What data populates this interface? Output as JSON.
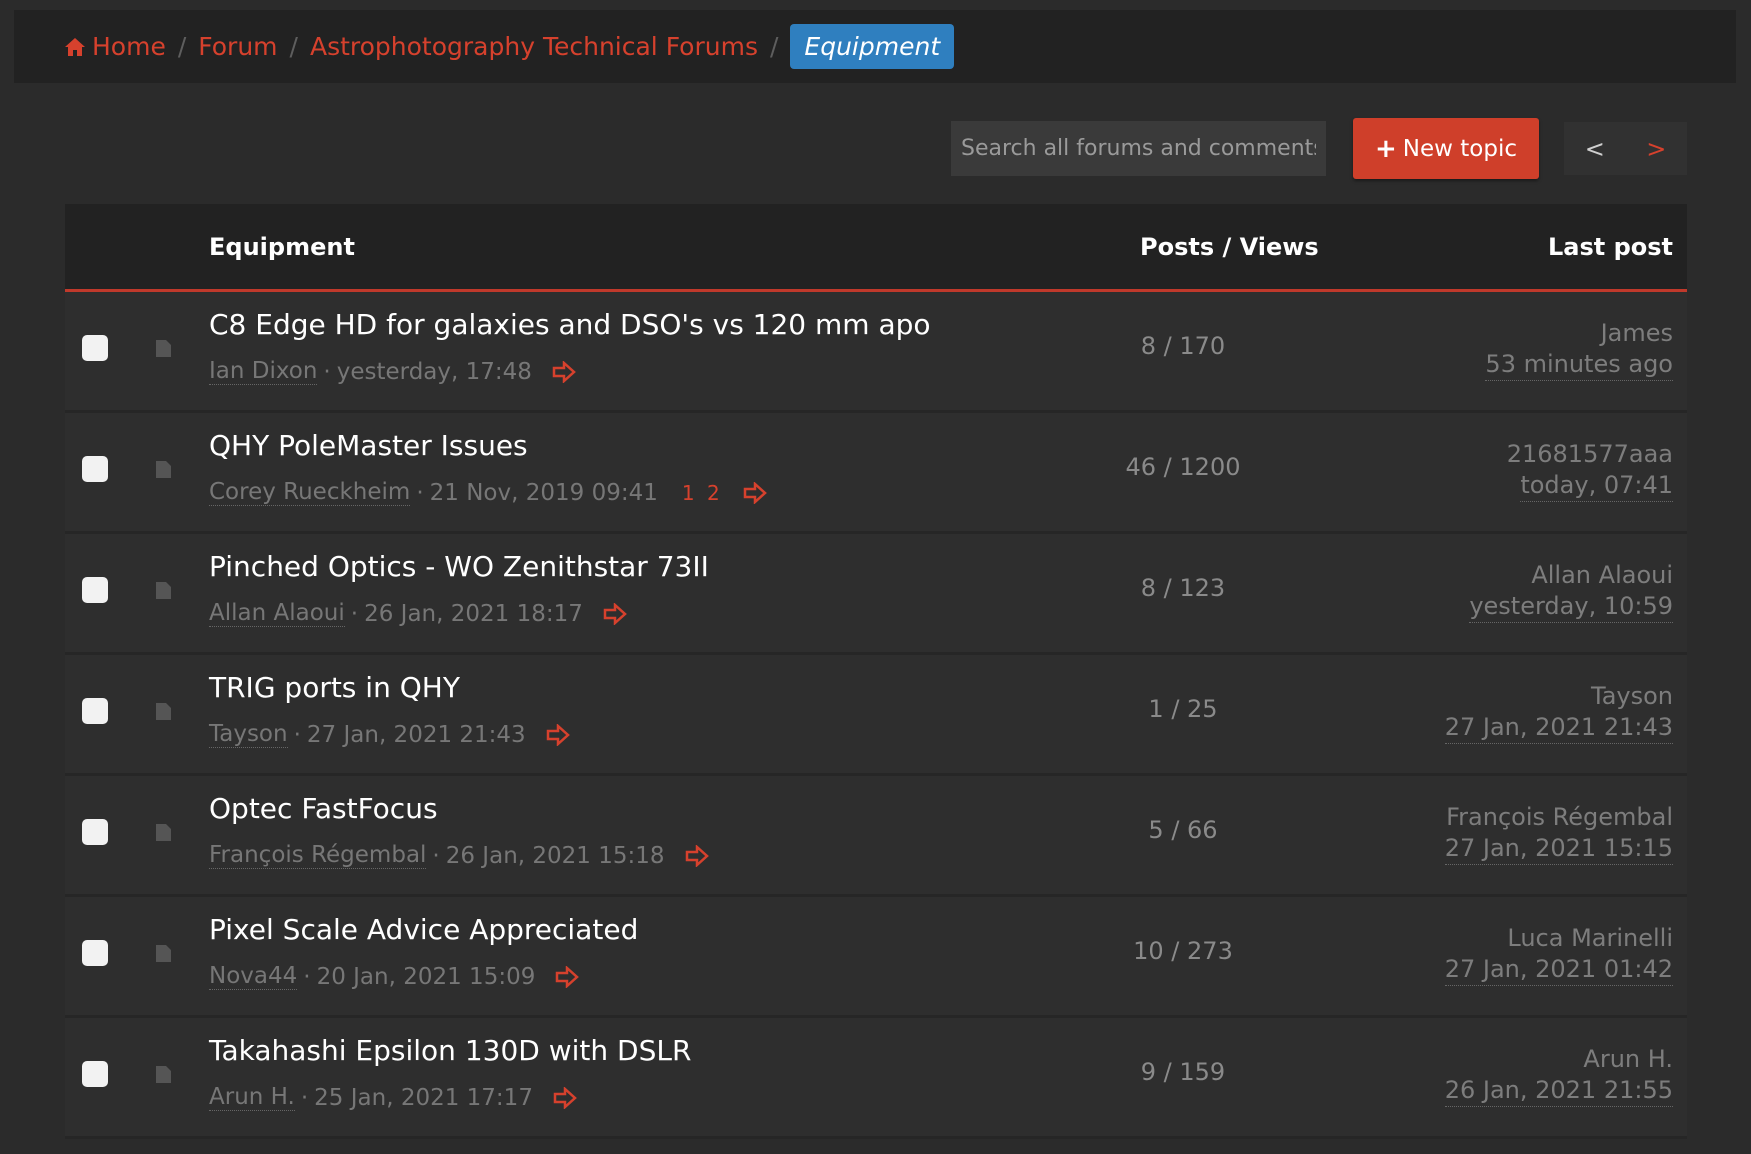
{
  "breadcrumb": {
    "home": "Home",
    "forum": "Forum",
    "section": "Astrophotography Technical Forums",
    "current": "Equipment",
    "separator": "/"
  },
  "toolbar": {
    "search_placeholder": "Search all forums and comments",
    "new_topic_label": "New topic",
    "new_topic_icon": "plus-icon",
    "prev_label": "<",
    "next_label": ">"
  },
  "table": {
    "headers": {
      "title": "Equipment",
      "posts_views": "Posts / Views",
      "last_post": "Last post"
    },
    "rows": [
      {
        "title": "C8 Edge HD for galaxies and DSO's vs 120 mm apo",
        "author": "Ian Dixon",
        "date": "yesterday, 17:48",
        "pages": "",
        "posts_views": "8 / 170",
        "last_user": "James",
        "last_time": "53 minutes ago"
      },
      {
        "title": "QHY PoleMaster Issues",
        "author": "Corey Rueckheim",
        "date": "21 Nov, 2019 09:41",
        "pages": "1 2",
        "posts_views": "46 / 1200",
        "last_user": "21681577aaa",
        "last_time": "today, 07:41"
      },
      {
        "title": "Pinched Optics - WO Zenithstar 73II",
        "author": "Allan Alaoui",
        "date": "26 Jan, 2021 18:17",
        "pages": "",
        "posts_views": "8 / 123",
        "last_user": "Allan Alaoui",
        "last_time": "yesterday, 10:59"
      },
      {
        "title": "TRIG ports in QHY",
        "author": "Tayson",
        "date": "27 Jan, 2021 21:43",
        "pages": "",
        "posts_views": "1 / 25",
        "last_user": "Tayson",
        "last_time": "27 Jan, 2021 21:43"
      },
      {
        "title": "Optec FastFocus",
        "author": "François Régembal",
        "date": "26 Jan, 2021 15:18",
        "pages": "",
        "posts_views": "5 / 66",
        "last_user": "François Régembal",
        "last_time": "27 Jan, 2021 15:15"
      },
      {
        "title": "Pixel Scale Advice Appreciated",
        "author": "Nova44",
        "date": "20 Jan, 2021 15:09",
        "pages": "",
        "posts_views": "10 / 273",
        "last_user": "Luca Marinelli",
        "last_time": "27 Jan, 2021 01:42"
      },
      {
        "title": "Takahashi Epsilon 130D with DSLR",
        "author": "Arun H.",
        "date": "25 Jan, 2021 17:17",
        "pages": "",
        "posts_views": "9 / 159",
        "last_user": "Arun H.",
        "last_time": "26 Jan, 2021 21:55"
      }
    ]
  },
  "colors": {
    "accent": "#d6412d",
    "current_crumb": "#2f7fbf",
    "background": "#2b2b2b"
  }
}
